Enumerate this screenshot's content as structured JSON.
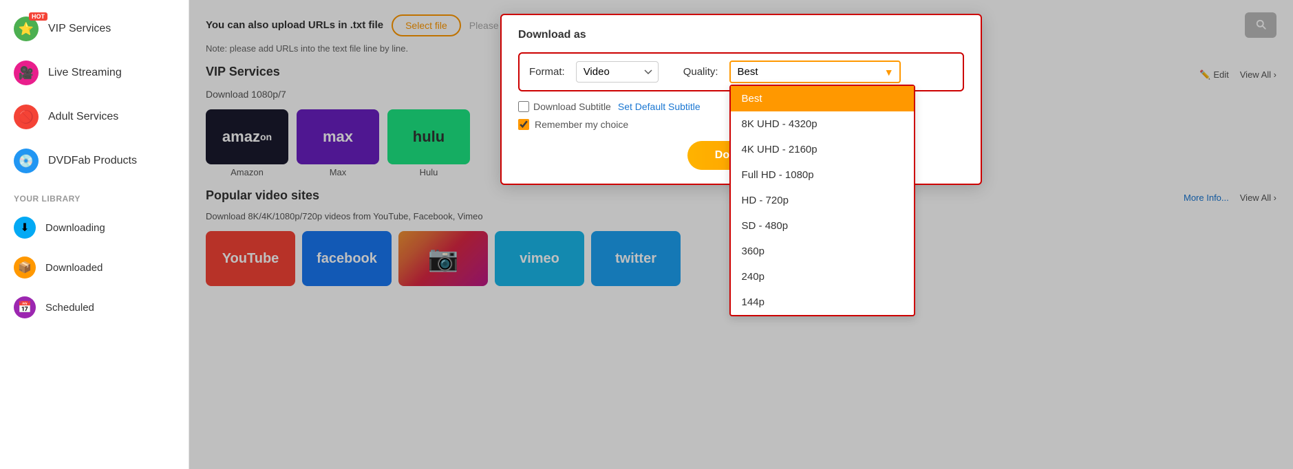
{
  "sidebar": {
    "items": [
      {
        "id": "vip-services",
        "label": "VIP Services",
        "iconColor": "green",
        "iconGlyph": "⭐",
        "hot": true
      },
      {
        "id": "live-streaming",
        "label": "Live Streaming",
        "iconColor": "pink",
        "iconGlyph": "🎥",
        "hot": false
      },
      {
        "id": "adult-services",
        "label": "Adult Services",
        "iconColor": "red",
        "iconGlyph": "🚫",
        "hot": false
      },
      {
        "id": "dvdfab-products",
        "label": "DVDFab Products",
        "iconColor": "blue",
        "iconGlyph": "💿",
        "hot": false
      }
    ],
    "library_label": "YOUR LIBRARY",
    "library_items": [
      {
        "id": "downloading",
        "label": "Downloading",
        "iconColor": "sky",
        "iconGlyph": "⬇"
      },
      {
        "id": "downloaded",
        "label": "Downloaded",
        "iconColor": "orange",
        "iconGlyph": "📦"
      },
      {
        "id": "scheduled",
        "label": "Scheduled",
        "iconColor": "purple",
        "iconGlyph": "📅"
      }
    ]
  },
  "url_section": {
    "upload_title": "You can also upload URLs in .txt file",
    "select_file_label": "Select file",
    "file_placeholder": "Please select a text file.",
    "note": "Note: please add URLs into the text file line by line."
  },
  "vip_section": {
    "title": "VIP Services",
    "download_label": "Download 1080p/7",
    "edit_label": "Edit",
    "view_all_label": "View All",
    "sites": [
      {
        "id": "amazon",
        "label": "Amazon",
        "display": "amaz",
        "color": "#1a1a2e"
      },
      {
        "id": "max",
        "label": "Max",
        "display": "max",
        "color": "#6a1fc2"
      },
      {
        "id": "hulu",
        "label": "Hulu",
        "display": "hulu",
        "color": "#1ce783"
      }
    ]
  },
  "popular_section": {
    "title": "Popular video sites",
    "description": "Download 8K/4K/1080p/720p videos from YouTube, Facebook, Vimeo",
    "more_info_label": "More Info...",
    "view_all_label": "View All",
    "sites": [
      {
        "id": "youtube",
        "label": "YouTube",
        "display": "YouTube",
        "color": "#f44336"
      },
      {
        "id": "facebook",
        "label": "Facebook",
        "display": "facebook",
        "color": "#1877f2"
      },
      {
        "id": "instagram",
        "label": "Instagram",
        "display": "📷",
        "color": "#e1306c"
      },
      {
        "id": "vimeo",
        "label": "Vimeo",
        "display": "vimeo",
        "color": "#1ab7ea"
      },
      {
        "id": "twitter",
        "label": "Twitter",
        "display": "twitter",
        "color": "#1da1f2"
      }
    ]
  },
  "dialog": {
    "title": "Download as",
    "format_label": "Format:",
    "format_value": "Video",
    "quality_label": "Quality:",
    "quality_value": "Best",
    "quality_options": [
      {
        "id": "best",
        "label": "Best",
        "selected": true
      },
      {
        "id": "8k",
        "label": "8K UHD - 4320p",
        "selected": false
      },
      {
        "id": "4k",
        "label": "4K UHD - 2160p",
        "selected": false
      },
      {
        "id": "1080p",
        "label": "Full HD - 1080p",
        "selected": false
      },
      {
        "id": "720p",
        "label": "HD - 720p",
        "selected": false
      },
      {
        "id": "480p",
        "label": "SD - 480p",
        "selected": false
      },
      {
        "id": "360p",
        "label": "360p",
        "selected": false
      },
      {
        "id": "240p",
        "label": "240p",
        "selected": false
      },
      {
        "id": "144p",
        "label": "144p",
        "selected": false
      }
    ],
    "subtitle_label": "Download Subtitle",
    "set_default_label": "Set Default Subtitle",
    "remember_label": "Remember my choice",
    "download_btn_label": "Download"
  }
}
